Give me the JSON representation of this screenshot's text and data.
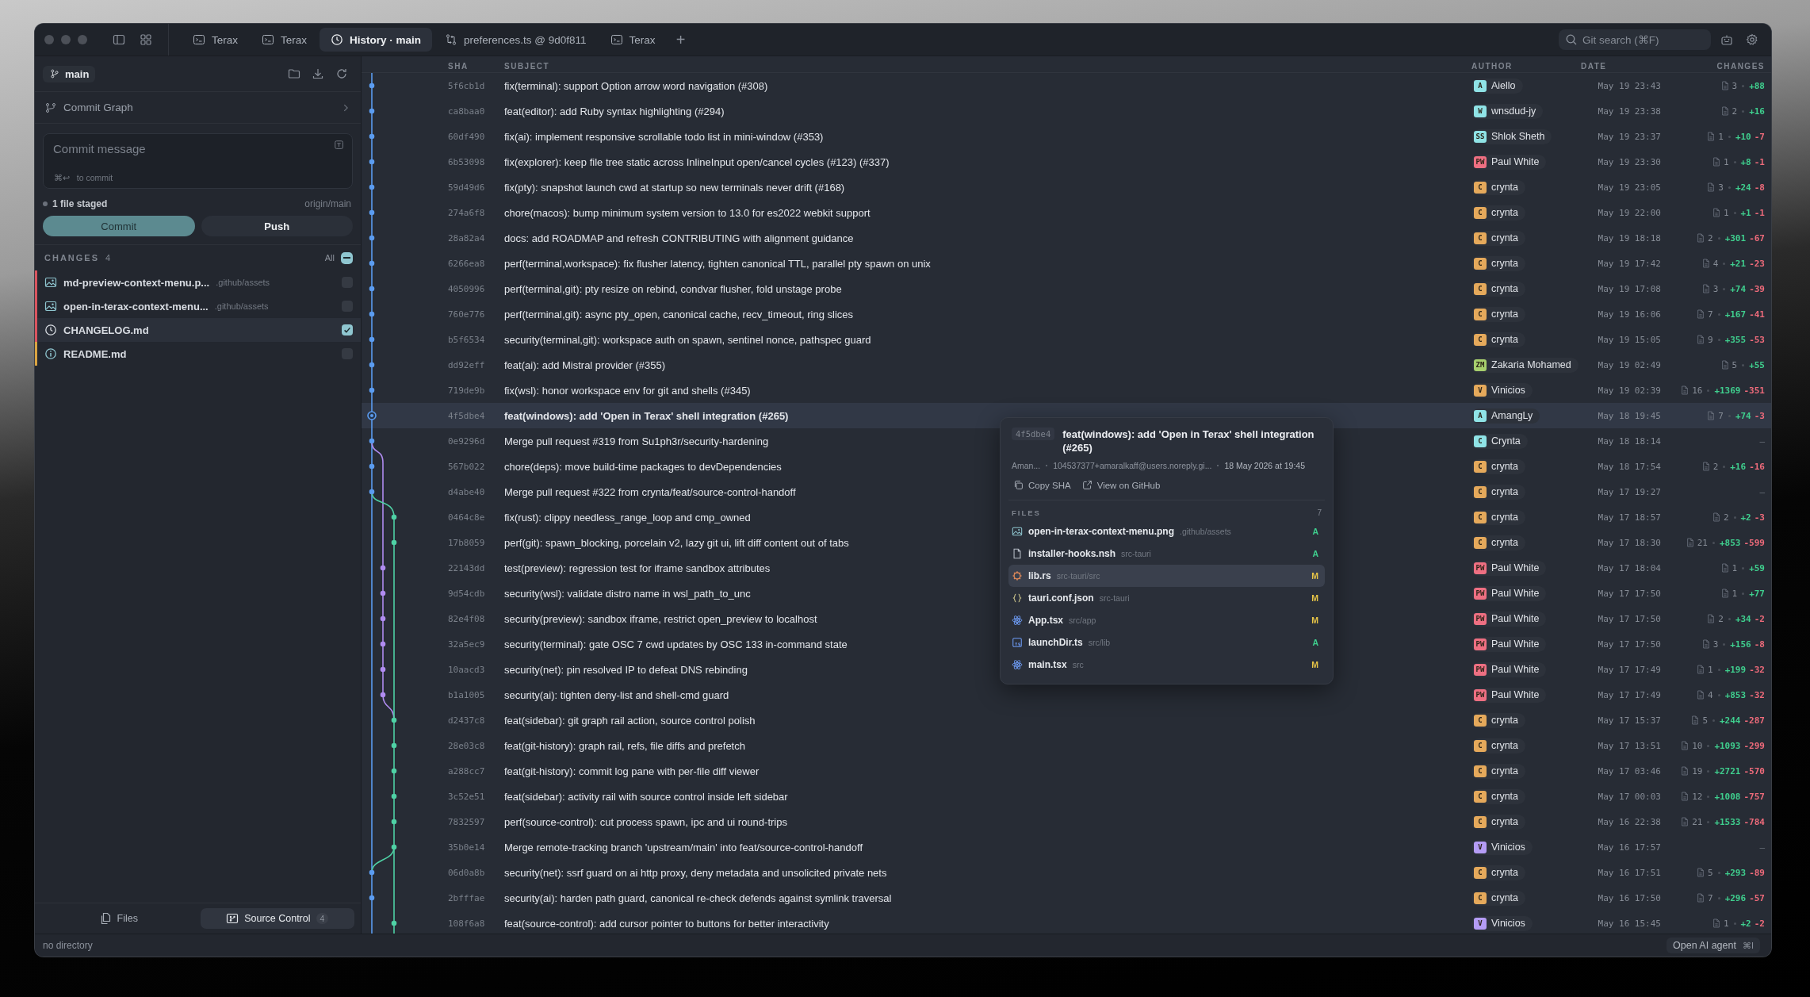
{
  "titlebar": {
    "tabs": [
      {
        "label": "Terax",
        "kind": "terminal",
        "selected": false
      },
      {
        "label": "Terax",
        "kind": "terminal",
        "selected": false
      },
      {
        "label": "History · main",
        "kind": "history",
        "selected": true
      },
      {
        "label": "preferences.ts @ 9d0f811",
        "kind": "diff",
        "selected": false
      },
      {
        "label": "Terax",
        "kind": "terminal",
        "selected": false
      }
    ],
    "add_tab": "+",
    "search": {
      "placeholder": "Git search (⌘F)"
    }
  },
  "sidebar": {
    "branch": "main",
    "commit_graph": "Commit Graph",
    "commit_box": {
      "placeholder": "Commit message",
      "hint": "⌘↩",
      "hint_text": "to commit"
    },
    "staged": "1 file staged",
    "remote": "origin/main",
    "buttons": [
      {
        "label": "Commit",
        "kind": "primary"
      },
      {
        "label": "Push",
        "kind": "secondary"
      }
    ],
    "changes": {
      "title": "CHANGES",
      "count": "4",
      "all_label": "All",
      "all_partial": true,
      "files": [
        {
          "name": "md-preview-context-menu.p...",
          "path": ".github/assets",
          "kind": "image",
          "color": "#d9545f",
          "checked": false
        },
        {
          "name": "open-in-terax-context-menu...",
          "path": ".github/assets",
          "kind": "image",
          "color": "#d9545f",
          "checked": false
        },
        {
          "name": "CHANGELOG.md",
          "kind": "history",
          "color": "#d9545f",
          "checked": true
        },
        {
          "name": "README.md",
          "kind": "info",
          "color": "#d9a441",
          "checked": false
        }
      ]
    },
    "bottom_tabs": [
      {
        "label": "Files",
        "kind": "files",
        "selected": false
      },
      {
        "label": "Source Control",
        "kind": "source",
        "badge": "4",
        "selected": true
      }
    ]
  },
  "table": {
    "columns": [
      "SHA",
      "SUBJECT",
      "AUTHOR",
      "DATE",
      "CHANGES"
    ],
    "rows": [
      {
        "sha": "5f6cb1d",
        "subject": "fix(terminal): support Option arrow word navigation (#308)",
        "initials": "A",
        "author": "Aiello",
        "color": "#8fe3e6",
        "date": "May 19 23:43",
        "changes": {
          "files": "3",
          "added": "+88"
        },
        "selected": false
      },
      {
        "sha": "ca8baa0",
        "subject": "feat(editor): add Ruby syntax highlighting (#294)",
        "initials": "W",
        "author": "wnsdud-jy",
        "color": "#8fe3e6",
        "date": "May 19 23:38",
        "changes": {
          "files": "2",
          "added": "+16"
        },
        "selected": false
      },
      {
        "sha": "60df490",
        "subject": "fix(ai): implement responsive scrollable todo list in mini-window (#353)",
        "initials": "SS",
        "author": "Shlok Sheth",
        "color": "#8fe3e6",
        "date": "May 19 23:37",
        "changes": {
          "files": "1",
          "added": "+10",
          "removed": "-7"
        },
        "selected": false
      },
      {
        "sha": "6b53098",
        "subject": "fix(explorer): keep file tree static across InlineInput open/cancel cycles (#123) (#337)",
        "initials": "PW",
        "author": "Paul White",
        "color": "#ee6f82",
        "date": "May 19 23:30",
        "changes": {
          "files": "1",
          "added": "+8",
          "removed": "-1"
        },
        "selected": false
      },
      {
        "sha": "59d49d6",
        "subject": "fix(pty): snapshot launch cwd at startup so new terminals never drift (#168)",
        "initials": "C",
        "author": "crynta",
        "color": "#e5a95b",
        "date": "May 19 23:05",
        "changes": {
          "files": "3",
          "added": "+24",
          "removed": "-8"
        },
        "selected": false
      },
      {
        "sha": "274a6f8",
        "subject": "chore(macos): bump minimum system version to 13.0 for es2022 webkit support",
        "initials": "C",
        "author": "crynta",
        "color": "#e5a95b",
        "date": "May 19 22:00",
        "changes": {
          "files": "1",
          "added": "+1",
          "removed": "-1"
        },
        "selected": false
      },
      {
        "sha": "28a82a4",
        "subject": "docs: add ROADMAP and refresh CONTRIBUTING with alignment guidance",
        "initials": "C",
        "author": "crynta",
        "color": "#e5a95b",
        "date": "May 19 18:18",
        "changes": {
          "files": "2",
          "added": "+301",
          "removed": "-67"
        },
        "selected": false
      },
      {
        "sha": "6266ea8",
        "subject": "perf(terminal,workspace): fix flusher latency, tighten canonical TTL, parallel pty spawn on unix",
        "initials": "C",
        "author": "crynta",
        "color": "#e5a95b",
        "date": "May 19 17:42",
        "changes": {
          "files": "4",
          "added": "+21",
          "removed": "-23"
        },
        "selected": false
      },
      {
        "sha": "4050996",
        "subject": "perf(terminal,git): pty resize on rebind, condvar flusher, fold unstage probe",
        "initials": "C",
        "author": "crynta",
        "color": "#e5a95b",
        "date": "May 19 17:08",
        "changes": {
          "files": "3",
          "added": "+74",
          "removed": "-39"
        },
        "selected": false
      },
      {
        "sha": "760e776",
        "subject": "perf(terminal,git): async pty_open, canonical cache, recv_timeout, ring slices",
        "initials": "C",
        "author": "crynta",
        "color": "#e5a95b",
        "date": "May 19 16:06",
        "changes": {
          "files": "7",
          "added": "+167",
          "removed": "-41"
        },
        "selected": false
      },
      {
        "sha": "b5f6534",
        "subject": "security(terminal,git): workspace auth on spawn, sentinel nonce, pathspec guard",
        "initials": "C",
        "author": "crynta",
        "color": "#e5a95b",
        "date": "May 19 15:05",
        "changes": {
          "files": "9",
          "added": "+355",
          "removed": "-53"
        },
        "selected": false
      },
      {
        "sha": "dd92eff",
        "subject": "feat(ai): add Mistral provider (#355)",
        "initials": "ZM",
        "author": "Zakaria Mohamed",
        "color": "#a7cf6d",
        "date": "May 19 02:49",
        "changes": {
          "files": "5",
          "added": "+55"
        },
        "selected": false
      },
      {
        "sha": "719de9b",
        "subject": "fix(wsl): honor workspace env for git and shells (#345)",
        "initials": "V",
        "author": "Vinicios",
        "color": "#e5a95b",
        "date": "May 19 02:39",
        "changes": {
          "files": "16",
          "added": "+1369",
          "removed": "-351"
        },
        "selected": false
      },
      {
        "sha": "4f5dbe4",
        "subject": "feat(windows): add 'Open in Terax' shell integration (#265)",
        "initials": "A",
        "author": "AmangLy",
        "color": "#8fe3e6",
        "date": "May 18 19:45",
        "changes": {
          "files": "7",
          "added": "+74",
          "removed": "-3"
        },
        "selected": true
      },
      {
        "sha": "0e9296d",
        "subject": "Merge pull request #319 from Su1ph3r/security-hardening",
        "initials": "C",
        "author": "Crynta",
        "color": "#8fe3e6",
        "date": "May 18 18:14",
        "changes": {
          "none": "–"
        },
        "selected": false
      },
      {
        "sha": "567b022",
        "subject": "chore(deps): move build-time packages to devDependencies",
        "initials": "C",
        "author": "crynta",
        "color": "#e5a95b",
        "date": "May 18 17:54",
        "changes": {
          "files": "2",
          "added": "+16",
          "removed": "-16"
        },
        "selected": false
      },
      {
        "sha": "d4abe40",
        "subject": "Merge pull request #322 from crynta/feat/source-control-handoff",
        "initials": "C",
        "author": "crynta",
        "color": "#e5a95b",
        "date": "May 17 19:27",
        "changes": {
          "none": "–"
        },
        "selected": false
      },
      {
        "sha": "0464c8e",
        "subject": "fix(rust): clippy needless_range_loop and cmp_owned",
        "initials": "C",
        "author": "crynta",
        "color": "#e5a95b",
        "date": "May 17 18:57",
        "changes": {
          "files": "2",
          "added": "+2",
          "removed": "-3"
        },
        "selected": false
      },
      {
        "sha": "17b8059",
        "subject": "perf(git): spawn_blocking, porcelain v2, lazy git ui, lift diff content out of tabs",
        "initials": "C",
        "author": "crynta",
        "color": "#e5a95b",
        "date": "May 17 18:30",
        "changes": {
          "files": "21",
          "added": "+853",
          "removed": "-599"
        },
        "selected": false
      },
      {
        "sha": "22143dd",
        "subject": "test(preview): regression test for iframe sandbox attributes",
        "initials": "PW",
        "author": "Paul White",
        "color": "#ee6f82",
        "date": "May 17 18:04",
        "changes": {
          "files": "1",
          "added": "+59"
        },
        "selected": false
      },
      {
        "sha": "9d54cdb",
        "subject": "security(wsl): validate distro name in wsl_path_to_unc",
        "initials": "PW",
        "author": "Paul White",
        "color": "#ee6f82",
        "date": "May 17 17:50",
        "changes": {
          "files": "1",
          "added": "+77"
        },
        "selected": false
      },
      {
        "sha": "82e4f08",
        "subject": "security(preview): sandbox iframe, restrict open_preview to localhost",
        "initials": "PW",
        "author": "Paul White",
        "color": "#ee6f82",
        "date": "May 17 17:50",
        "changes": {
          "files": "2",
          "added": "+34",
          "removed": "-2"
        },
        "selected": false
      },
      {
        "sha": "32a5ec9",
        "subject": "security(terminal): gate OSC 7 cwd updates by OSC 133 in-command state",
        "initials": "PW",
        "author": "Paul White",
        "color": "#ee6f82",
        "date": "May 17 17:50",
        "changes": {
          "files": "3",
          "added": "+156",
          "removed": "-8"
        },
        "selected": false
      },
      {
        "sha": "10aacd3",
        "subject": "security(net): pin resolved IP to defeat DNS rebinding",
        "initials": "PW",
        "author": "Paul White",
        "color": "#ee6f82",
        "date": "May 17 17:49",
        "changes": {
          "files": "1",
          "added": "+199",
          "removed": "-32"
        },
        "selected": false
      },
      {
        "sha": "b1a1005",
        "subject": "security(ai): tighten deny-list and shell-cmd guard",
        "initials": "PW",
        "author": "Paul White",
        "color": "#ee6f82",
        "date": "May 17 17:49",
        "changes": {
          "files": "4",
          "added": "+853",
          "removed": "-32"
        },
        "selected": false
      },
      {
        "sha": "d2437c8",
        "subject": "feat(sidebar): git graph rail action, source control polish",
        "initials": "C",
        "author": "crynta",
        "color": "#e5a95b",
        "date": "May 17 15:37",
        "changes": {
          "files": "5",
          "added": "+244",
          "removed": "-287"
        },
        "selected": false
      },
      {
        "sha": "28e03c8",
        "subject": "feat(git-history): graph rail, refs, file diffs and prefetch",
        "initials": "C",
        "author": "crynta",
        "color": "#e5a95b",
        "date": "May 17 13:51",
        "changes": {
          "files": "10",
          "added": "+1093",
          "removed": "-299"
        },
        "selected": false
      },
      {
        "sha": "a288cc7",
        "subject": "feat(git-history): commit log pane with per-file diff viewer",
        "initials": "C",
        "author": "crynta",
        "color": "#e5a95b",
        "date": "May 17 03:46",
        "changes": {
          "files": "19",
          "added": "+2721",
          "removed": "-570"
        },
        "selected": false
      },
      {
        "sha": "3c52e51",
        "subject": "feat(sidebar): activity rail with source control inside left sidebar",
        "initials": "C",
        "author": "crynta",
        "color": "#e5a95b",
        "date": "May 17 00:03",
        "changes": {
          "files": "12",
          "added": "+1008",
          "removed": "-757"
        },
        "selected": false
      },
      {
        "sha": "7832597",
        "subject": "perf(source-control): cut process spawn, ipc and ui round-trips",
        "initials": "C",
        "author": "crynta",
        "color": "#e5a95b",
        "date": "May 16 22:38",
        "changes": {
          "files": "21",
          "added": "+1533",
          "removed": "-784"
        },
        "selected": false
      },
      {
        "sha": "35b0e14",
        "subject": "Merge remote-tracking branch 'upstream/main' into feat/source-control-handoff",
        "initials": "V",
        "author": "Vinicios",
        "color": "#b49cf5",
        "date": "May 16 17:57",
        "changes": {
          "none": "–"
        },
        "selected": false
      },
      {
        "sha": "06d0a8b",
        "subject": "security(net): ssrf guard on ai http proxy, deny metadata and unsolicited private nets",
        "initials": "C",
        "author": "crynta",
        "color": "#e5a95b",
        "date": "May 16 17:51",
        "changes": {
          "files": "5",
          "added": "+293",
          "removed": "-89"
        },
        "selected": false
      },
      {
        "sha": "2bfffae",
        "subject": "security(ai): harden path guard, canonical re-check defends against symlink traversal",
        "initials": "C",
        "author": "crynta",
        "color": "#e5a95b",
        "date": "May 16 17:50",
        "changes": {
          "files": "7",
          "added": "+296",
          "removed": "-57"
        },
        "selected": false
      },
      {
        "sha": "108f6a8",
        "subject": "feat(source-control): add cursor pointer to buttons for better interactivity",
        "initials": "V",
        "author": "Vinicios",
        "color": "#b49cf5",
        "date": "May 16 15:45",
        "changes": {
          "files": "1",
          "added": "+2",
          "removed": "-2"
        },
        "selected": false
      }
    ]
  },
  "popover": {
    "sha": "4f5dbe4",
    "title": "feat(windows): add 'Open in Terax' shell integration (#265)",
    "author": "Aman...",
    "email": "104537377+amaralkaff@users.noreply.gi...",
    "date": "18 May 2026 at 19:45",
    "actions": [
      {
        "label": "Copy SHA",
        "kind": "copy"
      },
      {
        "label": "View on GitHub",
        "kind": "external"
      }
    ],
    "files_title": "FILES",
    "files_count": "7",
    "files": [
      {
        "name": "open-in-terax-context-menu.png",
        "path": ".github/assets",
        "kind": "image",
        "status": "A",
        "color": "#3fcf8e",
        "selected": false
      },
      {
        "name": "installer-hooks.nsh",
        "path": "src-tauri",
        "kind": "file",
        "status": "A",
        "color": "#3fcf8e",
        "selected": false
      },
      {
        "name": "lib.rs",
        "path": "src-tauri/src",
        "kind": "rust",
        "status": "M",
        "color": "#e8c547",
        "selected": true
      },
      {
        "name": "tauri.conf.json",
        "path": "src-tauri",
        "kind": "json",
        "status": "M",
        "color": "#e8c547",
        "selected": false
      },
      {
        "name": "App.tsx",
        "path": "src/app",
        "kind": "react",
        "status": "M",
        "color": "#e8c547",
        "selected": false
      },
      {
        "name": "launchDir.ts",
        "path": "src/lib",
        "kind": "ts",
        "status": "A",
        "color": "#3fcf8e",
        "selected": false
      },
      {
        "name": "main.tsx",
        "path": "src",
        "kind": "react",
        "status": "M",
        "color": "#e8c547",
        "selected": false
      }
    ]
  },
  "status_bar": {
    "left": "no directory",
    "agent_button": "Open AI agent",
    "agent_shortcut": "⌘I"
  }
}
